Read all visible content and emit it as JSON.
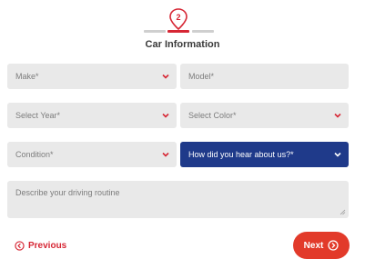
{
  "stepper": {
    "current_step": "2",
    "title": "Car Information"
  },
  "form": {
    "make": {
      "placeholder": "Make*"
    },
    "model": {
      "placeholder": "Model*"
    },
    "year": {
      "placeholder": "Select Year*"
    },
    "color": {
      "placeholder": "Select Color*"
    },
    "condition": {
      "placeholder": "Condition*"
    },
    "referral": {
      "placeholder": "How did you hear about us?*"
    },
    "routine": {
      "placeholder": "Describe your driving routine"
    }
  },
  "nav": {
    "previous_label": "Previous",
    "next_label": "Next"
  },
  "colors": {
    "accent": "#d62634",
    "select_active": "#1f3a8a",
    "next_button": "#e23a2a",
    "field_bg": "#e9e9e9"
  }
}
